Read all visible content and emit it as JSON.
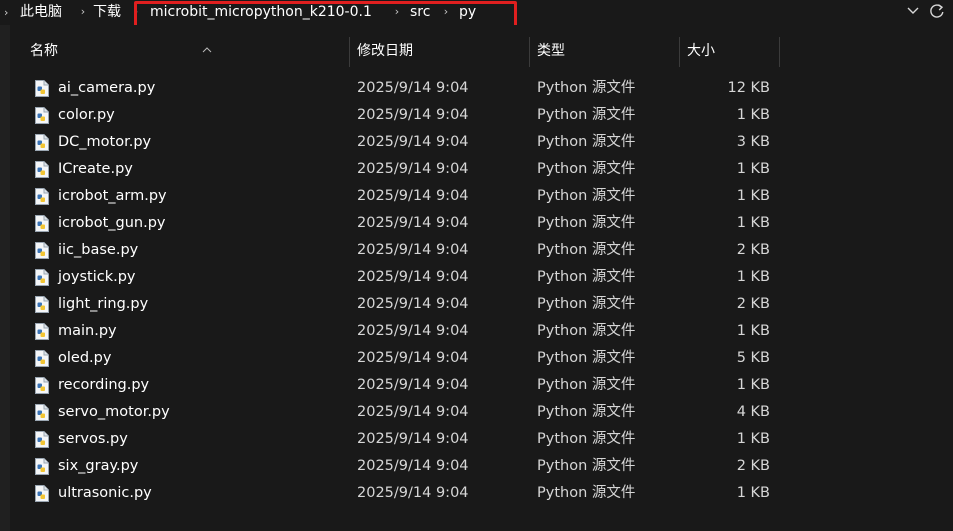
{
  "address_bar": {
    "crumbs": [
      "此电脑",
      "下载",
      "microbit_micropython_k210-0.1",
      "src",
      "py"
    ],
    "highlight_color": "#e01f1f"
  },
  "columns": {
    "name": "名称",
    "date": "修改日期",
    "type": "类型",
    "size": "大小"
  },
  "files": [
    {
      "name": "ai_camera.py",
      "date": "2025/9/14 9:04",
      "type": "Python 源文件",
      "size": "12 KB"
    },
    {
      "name": "color.py",
      "date": "2025/9/14 9:04",
      "type": "Python 源文件",
      "size": "1 KB"
    },
    {
      "name": "DC_motor.py",
      "date": "2025/9/14 9:04",
      "type": "Python 源文件",
      "size": "3 KB"
    },
    {
      "name": "ICreate.py",
      "date": "2025/9/14 9:04",
      "type": "Python 源文件",
      "size": "1 KB"
    },
    {
      "name": "icrobot_arm.py",
      "date": "2025/9/14 9:04",
      "type": "Python 源文件",
      "size": "1 KB"
    },
    {
      "name": "icrobot_gun.py",
      "date": "2025/9/14 9:04",
      "type": "Python 源文件",
      "size": "1 KB"
    },
    {
      "name": "iic_base.py",
      "date": "2025/9/14 9:04",
      "type": "Python 源文件",
      "size": "2 KB"
    },
    {
      "name": "joystick.py",
      "date": "2025/9/14 9:04",
      "type": "Python 源文件",
      "size": "1 KB"
    },
    {
      "name": "light_ring.py",
      "date": "2025/9/14 9:04",
      "type": "Python 源文件",
      "size": "2 KB"
    },
    {
      "name": "main.py",
      "date": "2025/9/14 9:04",
      "type": "Python 源文件",
      "size": "1 KB"
    },
    {
      "name": "oled.py",
      "date": "2025/9/14 9:04",
      "type": "Python 源文件",
      "size": "5 KB"
    },
    {
      "name": "recording.py",
      "date": "2025/9/14 9:04",
      "type": "Python 源文件",
      "size": "1 KB"
    },
    {
      "name": "servo_motor.py",
      "date": "2025/9/14 9:04",
      "type": "Python 源文件",
      "size": "4 KB"
    },
    {
      "name": "servos.py",
      "date": "2025/9/14 9:04",
      "type": "Python 源文件",
      "size": "1 KB"
    },
    {
      "name": "six_gray.py",
      "date": "2025/9/14 9:04",
      "type": "Python 源文件",
      "size": "2 KB"
    },
    {
      "name": "ultrasonic.py",
      "date": "2025/9/14 9:04",
      "type": "Python 源文件",
      "size": "1 KB"
    }
  ],
  "icons": {
    "file": "python-file-icon",
    "dropdown": "chevron-down-icon",
    "refresh": "refresh-icon"
  }
}
